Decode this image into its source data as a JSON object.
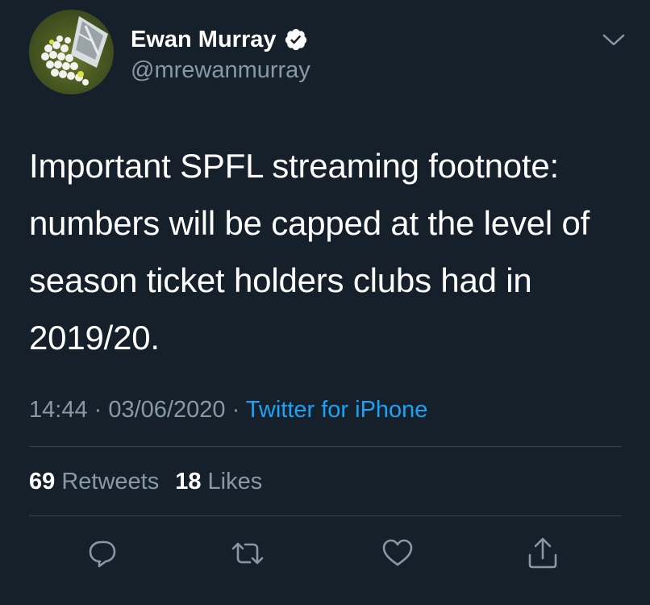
{
  "author": {
    "name": "Ewan Murray",
    "handle": "@mrewanmurray",
    "verified": true
  },
  "tweet": {
    "text": "Important SPFL streaming footnote: numbers will be capped at the level of season ticket holders clubs had in 2019/20.",
    "time": "14:44",
    "date": "03/06/2020",
    "separator": " · ",
    "source": "Twitter for iPhone"
  },
  "stats": {
    "retweets_count": "69",
    "retweets_label": "Retweets",
    "likes_count": "18",
    "likes_label": "Likes"
  },
  "actions": [
    "reply-icon",
    "retweet-icon",
    "like-icon",
    "share-icon"
  ],
  "colors": {
    "background": "#15202b",
    "secondary_text": "#8899a6",
    "link": "#1da1f2",
    "divider": "#38444d"
  }
}
